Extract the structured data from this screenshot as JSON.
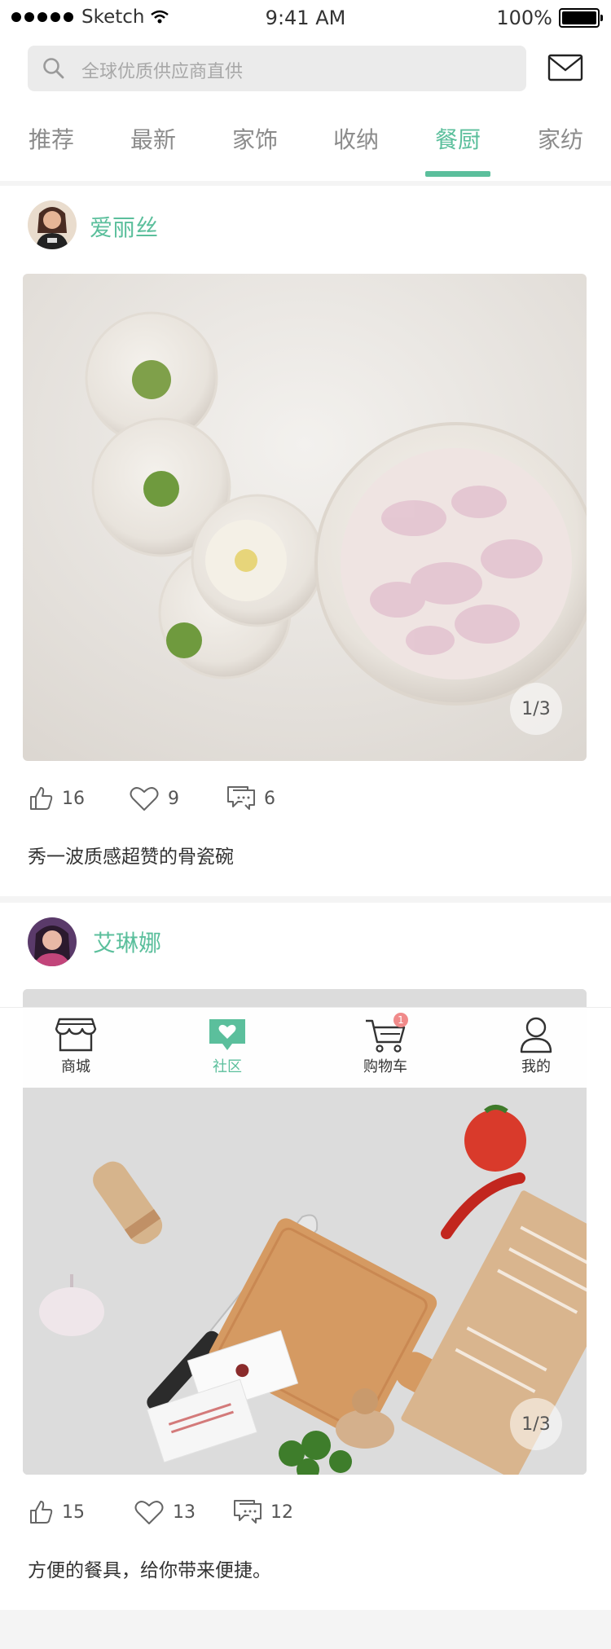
{
  "status_bar": {
    "carrier": "Sketch",
    "time": "9:41 AM",
    "battery": "100%"
  },
  "search": {
    "placeholder": "全球优质供应商直供"
  },
  "icons": {
    "search": "search-icon",
    "mail": "mail-icon",
    "like": "thumbs-up-icon",
    "favorite": "heart-icon",
    "comment": "comment-icon"
  },
  "tabs": [
    {
      "label": "推荐"
    },
    {
      "label": "最新"
    },
    {
      "label": "家饰"
    },
    {
      "label": "收纳"
    },
    {
      "label": "餐厨",
      "active": true
    },
    {
      "label": "家纺"
    }
  ],
  "colors": {
    "accent": "#5bbf9c",
    "badge": "#f08a8a"
  },
  "posts": [
    {
      "user": "爱丽丝",
      "image_counter": "1/3",
      "likes": "16",
      "favorites": "9",
      "comments": "6",
      "caption": "秀一波质感超赞的骨瓷碗"
    },
    {
      "user": "艾琳娜",
      "image_counter": "1/3",
      "likes": "15",
      "favorites": "13",
      "comments": "12",
      "caption": "方便的餐具，给你带来便捷。"
    }
  ],
  "bottom_nav": [
    {
      "label": "商城",
      "icon": "shop-icon"
    },
    {
      "label": "社区",
      "icon": "community-icon",
      "active": true
    },
    {
      "label": "购物车",
      "icon": "cart-icon",
      "badge": "1"
    },
    {
      "label": "我的",
      "icon": "user-icon"
    }
  ]
}
